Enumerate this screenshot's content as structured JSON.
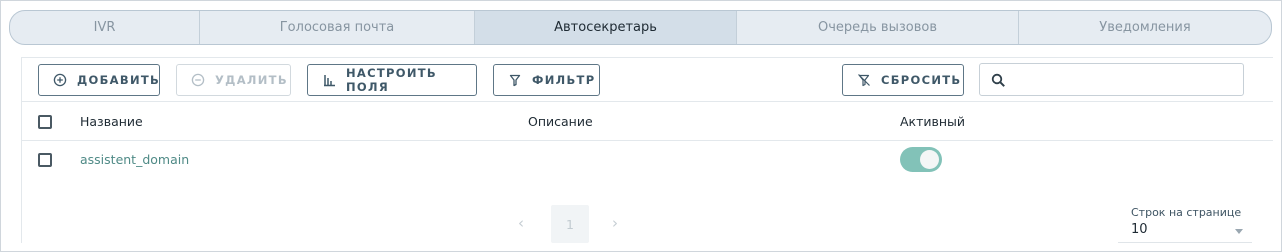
{
  "tabs": [
    {
      "label": "IVR",
      "active": false
    },
    {
      "label": "Голосовая почта",
      "active": false
    },
    {
      "label": "Автосекретарь",
      "active": true
    },
    {
      "label": "Очередь вызовов",
      "active": false
    },
    {
      "label": "Уведомления",
      "active": false
    }
  ],
  "toolbar": {
    "add_label": "ДОБАВИТЬ",
    "delete_label": "УДАЛИТЬ",
    "configure_label": "НАСТРОИТЬ ПОЛЯ",
    "filter_label": "ФИЛЬТР",
    "reset_label": "СБРОСИТЬ",
    "search_value": ""
  },
  "table": {
    "columns": {
      "name": "Название",
      "description": "Описание",
      "active": "Активный"
    },
    "rows": [
      {
        "name": "assistent_domain",
        "description": "",
        "active": true,
        "selected": false
      }
    ]
  },
  "pagination": {
    "current_page": "1",
    "rows_per_page_label": "Строк на странице",
    "rows_per_page_value": "10"
  },
  "colors": {
    "accent": "#4f8a86",
    "toggle_on": "#82c2b8",
    "tab_active_bg": "#d3dee8",
    "tab_bg": "#e6ecf2"
  }
}
